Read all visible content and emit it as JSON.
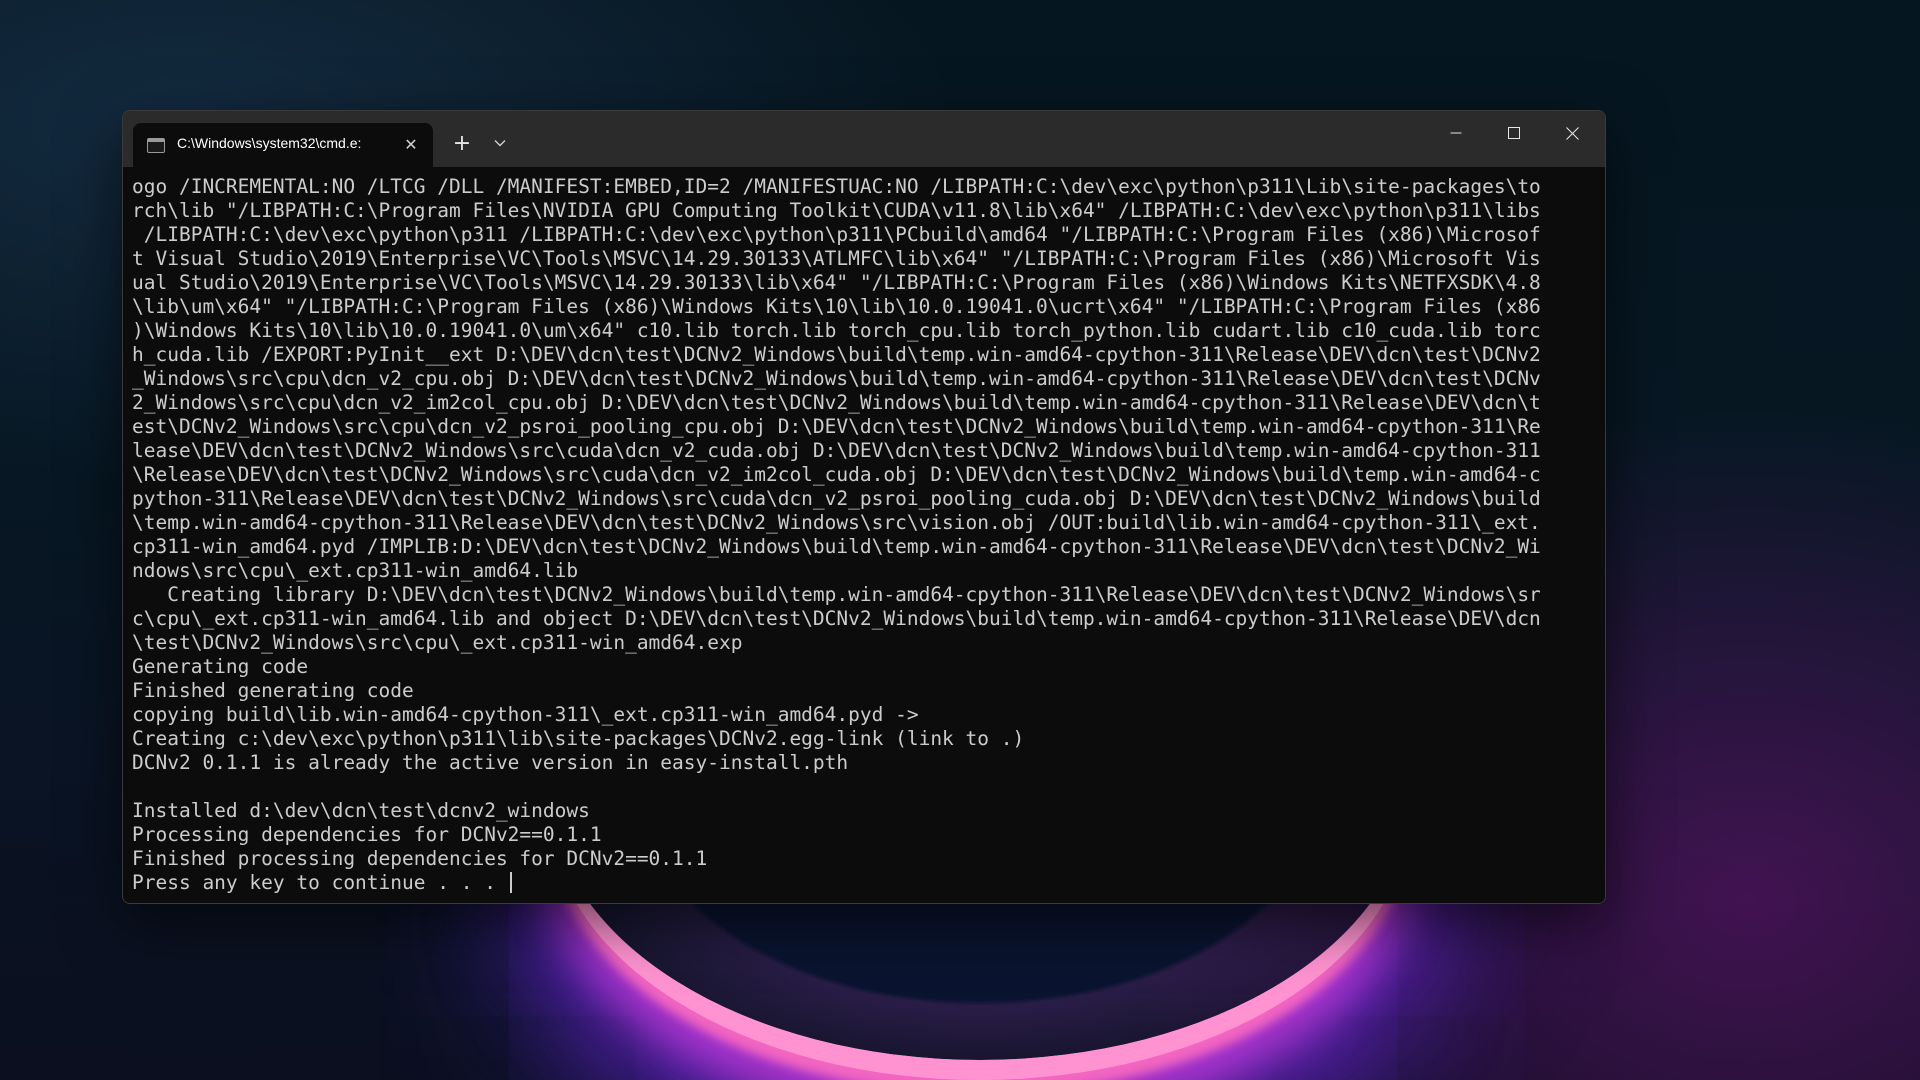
{
  "window": {
    "tab_title": "C:\\Windows\\system32\\cmd.e:",
    "tab_close_glyph": "✕",
    "new_tab_glyph": "+",
    "icons": {
      "tab": "cmd-terminal-icon",
      "close_tab": "close-icon",
      "new_tab": "plus-icon",
      "dropdown": "chevron-down-icon",
      "minimize": "minimize-icon",
      "maximize": "maximize-icon",
      "close_window": "close-icon"
    }
  },
  "console": {
    "lines": [
      "ogo /INCREMENTAL:NO /LTCG /DLL /MANIFEST:EMBED,ID=2 /MANIFESTUAC:NO /LIBPATH:C:\\dev\\exc\\python\\p311\\Lib\\site-packages\\to",
      "rch\\lib \"/LIBPATH:C:\\Program Files\\NVIDIA GPU Computing Toolkit\\CUDA\\v11.8\\lib\\x64\" /LIBPATH:C:\\dev\\exc\\python\\p311\\libs",
      " /LIBPATH:C:\\dev\\exc\\python\\p311 /LIBPATH:C:\\dev\\exc\\python\\p311\\PCbuild\\amd64 \"/LIBPATH:C:\\Program Files (x86)\\Microsof",
      "t Visual Studio\\2019\\Enterprise\\VC\\Tools\\MSVC\\14.29.30133\\ATLMFC\\lib\\x64\" \"/LIBPATH:C:\\Program Files (x86)\\Microsoft Vis",
      "ual Studio\\2019\\Enterprise\\VC\\Tools\\MSVC\\14.29.30133\\lib\\x64\" \"/LIBPATH:C:\\Program Files (x86)\\Windows Kits\\NETFXSDK\\4.8",
      "\\lib\\um\\x64\" \"/LIBPATH:C:\\Program Files (x86)\\Windows Kits\\10\\lib\\10.0.19041.0\\ucrt\\x64\" \"/LIBPATH:C:\\Program Files (x86",
      ")\\Windows Kits\\10\\lib\\10.0.19041.0\\um\\x64\" c10.lib torch.lib torch_cpu.lib torch_python.lib cudart.lib c10_cuda.lib torc",
      "h_cuda.lib /EXPORT:PyInit__ext D:\\DEV\\dcn\\test\\DCNv2_Windows\\build\\temp.win-amd64-cpython-311\\Release\\DEV\\dcn\\test\\DCNv2",
      "_Windows\\src\\cpu\\dcn_v2_cpu.obj D:\\DEV\\dcn\\test\\DCNv2_Windows\\build\\temp.win-amd64-cpython-311\\Release\\DEV\\dcn\\test\\DCNv",
      "2_Windows\\src\\cpu\\dcn_v2_im2col_cpu.obj D:\\DEV\\dcn\\test\\DCNv2_Windows\\build\\temp.win-amd64-cpython-311\\Release\\DEV\\dcn\\t",
      "est\\DCNv2_Windows\\src\\cpu\\dcn_v2_psroi_pooling_cpu.obj D:\\DEV\\dcn\\test\\DCNv2_Windows\\build\\temp.win-amd64-cpython-311\\Re",
      "lease\\DEV\\dcn\\test\\DCNv2_Windows\\src\\cuda\\dcn_v2_cuda.obj D:\\DEV\\dcn\\test\\DCNv2_Windows\\build\\temp.win-amd64-cpython-311",
      "\\Release\\DEV\\dcn\\test\\DCNv2_Windows\\src\\cuda\\dcn_v2_im2col_cuda.obj D:\\DEV\\dcn\\test\\DCNv2_Windows\\build\\temp.win-amd64-c",
      "python-311\\Release\\DEV\\dcn\\test\\DCNv2_Windows\\src\\cuda\\dcn_v2_psroi_pooling_cuda.obj D:\\DEV\\dcn\\test\\DCNv2_Windows\\build",
      "\\temp.win-amd64-cpython-311\\Release\\DEV\\dcn\\test\\DCNv2_Windows\\src\\vision.obj /OUT:build\\lib.win-amd64-cpython-311\\_ext.",
      "cp311-win_amd64.pyd /IMPLIB:D:\\DEV\\dcn\\test\\DCNv2_Windows\\build\\temp.win-amd64-cpython-311\\Release\\DEV\\dcn\\test\\DCNv2_Wi",
      "ndows\\src\\cpu\\_ext.cp311-win_amd64.lib",
      "   Creating library D:\\DEV\\dcn\\test\\DCNv2_Windows\\build\\temp.win-amd64-cpython-311\\Release\\DEV\\dcn\\test\\DCNv2_Windows\\sr",
      "c\\cpu\\_ext.cp311-win_amd64.lib and object D:\\DEV\\dcn\\test\\DCNv2_Windows\\build\\temp.win-amd64-cpython-311\\Release\\DEV\\dcn",
      "\\test\\DCNv2_Windows\\src\\cpu\\_ext.cp311-win_amd64.exp",
      "Generating code",
      "Finished generating code",
      "copying build\\lib.win-amd64-cpython-311\\_ext.cp311-win_amd64.pyd ->",
      "Creating c:\\dev\\exc\\python\\p311\\lib\\site-packages\\DCNv2.egg-link (link to .)",
      "DCNv2 0.1.1 is already the active version in easy-install.pth",
      "",
      "Installed d:\\dev\\dcn\\test\\dcnv2_windows",
      "Processing dependencies for DCNv2==0.1.1",
      "Finished processing dependencies for DCNv2==0.1.1",
      "Press any key to continue . . . "
    ]
  }
}
